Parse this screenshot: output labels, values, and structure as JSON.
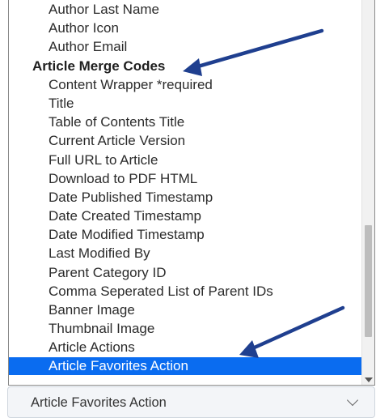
{
  "dropdown": {
    "options": [
      {
        "label": "Author Last Name",
        "kind": "child"
      },
      {
        "label": "Author Icon",
        "kind": "child"
      },
      {
        "label": "Author Email",
        "kind": "child"
      },
      {
        "label": "Article Merge Codes",
        "kind": "group"
      },
      {
        "label": "Content Wrapper *required",
        "kind": "child"
      },
      {
        "label": "Title",
        "kind": "child"
      },
      {
        "label": "Table of Contents Title",
        "kind": "child"
      },
      {
        "label": "Current Article Version",
        "kind": "child"
      },
      {
        "label": "Full URL to Article",
        "kind": "child"
      },
      {
        "label": "Download to PDF HTML",
        "kind": "child"
      },
      {
        "label": "Date Published Timestamp",
        "kind": "child"
      },
      {
        "label": "Date Created Timestamp",
        "kind": "child"
      },
      {
        "label": "Date Modified Timestamp",
        "kind": "child"
      },
      {
        "label": "Last Modified By",
        "kind": "child"
      },
      {
        "label": "Parent Category ID",
        "kind": "child"
      },
      {
        "label": "Comma Seperated List of Parent IDs",
        "kind": "child"
      },
      {
        "label": "Banner Image",
        "kind": "child"
      },
      {
        "label": "Thumbnail Image",
        "kind": "child"
      },
      {
        "label": "Article Actions",
        "kind": "child"
      },
      {
        "label": "Article Favorites Action",
        "kind": "child",
        "selected": true
      }
    ],
    "highlight_color": "#0a6cf0"
  },
  "select": {
    "value": "Article Favorites Action",
    "icon": "chevron-down-icon"
  },
  "annotations": {
    "arrow_color": "#1f3f8f"
  }
}
